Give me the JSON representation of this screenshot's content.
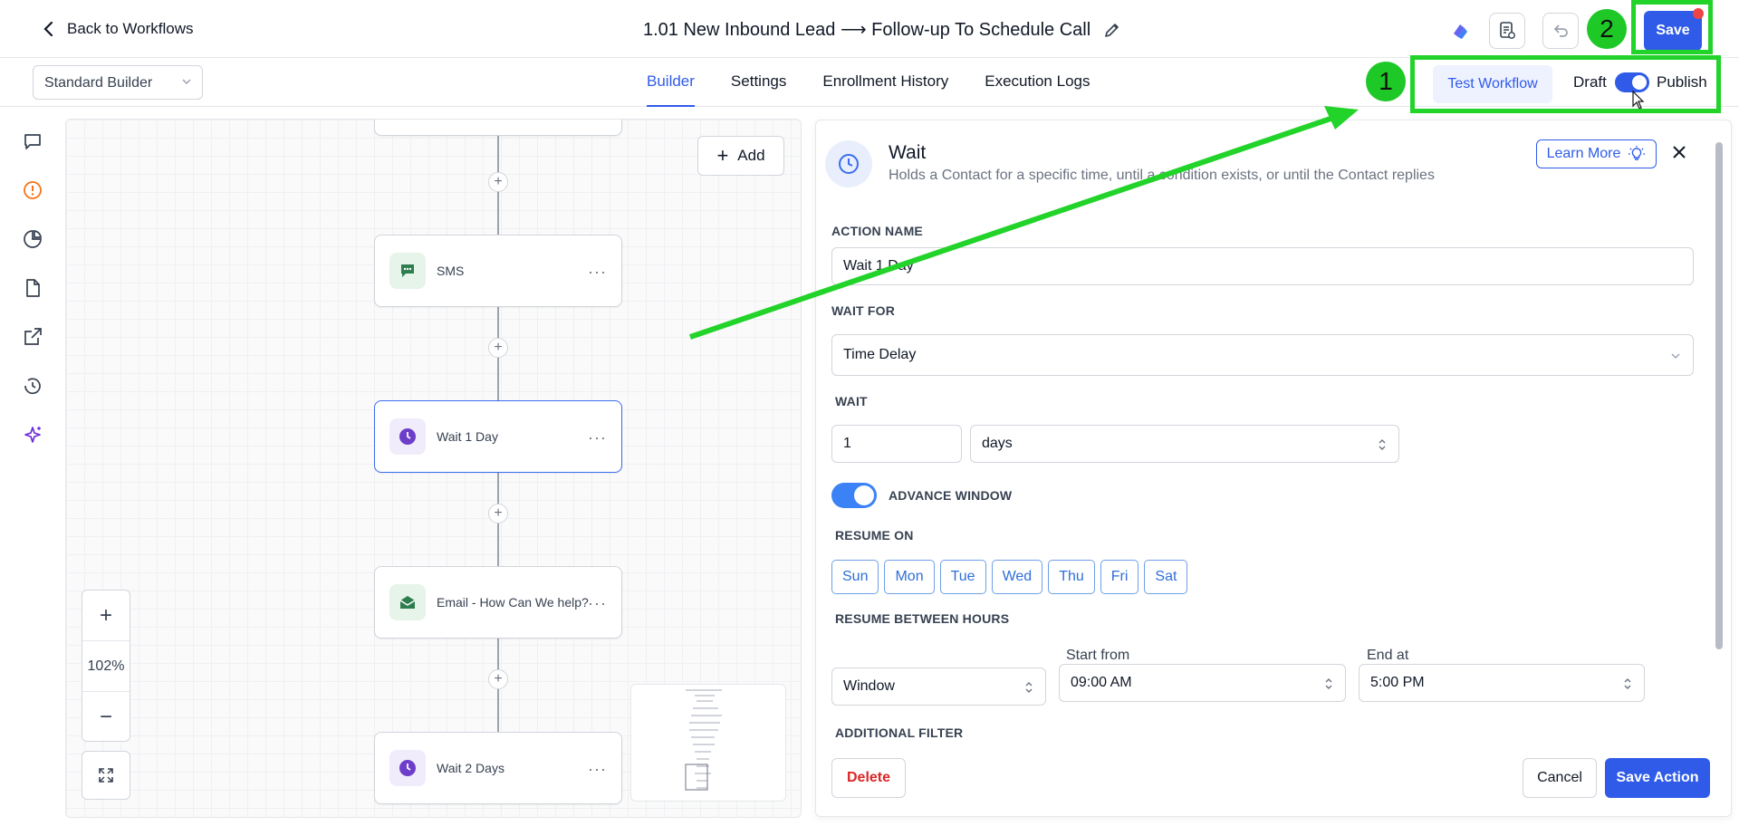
{
  "header": {
    "back_label": "Back to Workflows",
    "workflow_title": "1.01 New Inbound Lead ⟶ Follow-up To Schedule Call",
    "save_label": "Save"
  },
  "subbar": {
    "builder_select": "Standard Builder",
    "tabs": [
      {
        "label": "Builder",
        "active": true
      },
      {
        "label": "Settings"
      },
      {
        "label": "Enrollment History"
      },
      {
        "label": "Execution Logs"
      }
    ],
    "test_workflow_label": "Test Workflow",
    "draft_label": "Draft",
    "publish_label": "Publish"
  },
  "canvas": {
    "add_label": "Add",
    "zoom_level": "102%",
    "zoom_in": "+",
    "zoom_out": "−",
    "nodes": [
      {
        "label": "SMS",
        "icon": "sms-icon"
      },
      {
        "label": "Wait 1 Day",
        "icon": "clock-icon"
      },
      {
        "label": "Email - How Can We help?",
        "icon": "email-icon"
      },
      {
        "label": "Wait 2 Days",
        "icon": "clock-icon"
      }
    ]
  },
  "panel": {
    "title": "Wait",
    "description": "Holds a Contact for a specific time, until a condition exists, or until the Contact replies",
    "learn_more": "Learn More",
    "action_name_label": "ACTION NAME",
    "action_name_value": "Wait 1 Day",
    "wait_for_label": "WAIT FOR",
    "wait_for_value": "Time Delay",
    "wait_label": "WAIT",
    "wait_amount": "1",
    "wait_unit": "days",
    "advance_window_label": "ADVANCE WINDOW",
    "resume_on_label": "RESUME ON",
    "days": [
      "Sun",
      "Mon",
      "Tue",
      "Wed",
      "Thu",
      "Fri",
      "Sat"
    ],
    "resume_hours_label": "RESUME BETWEEN HOURS",
    "window_value": "Window",
    "start_label": "Start from",
    "start_value": "09:00 AM",
    "end_label": "End at",
    "end_value": "5:00 PM",
    "additional_filter_label": "ADDITIONAL FILTER",
    "delete_label": "Delete",
    "cancel_label": "Cancel",
    "save_action_label": "Save Action"
  },
  "annotations": {
    "badge_1": "1",
    "badge_2": "2",
    "color": "#22d32a"
  }
}
